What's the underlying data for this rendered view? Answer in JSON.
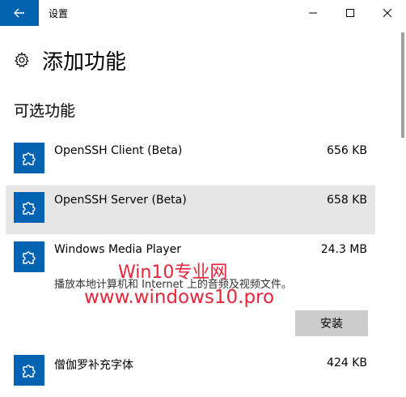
{
  "window": {
    "title": "设置"
  },
  "page": {
    "title": "添加功能"
  },
  "section": {
    "title": "可选功能"
  },
  "items": [
    {
      "name": "OpenSSH Client (Beta)",
      "size": "656 KB"
    },
    {
      "name": "OpenSSH Server (Beta)",
      "size": "658 KB"
    },
    {
      "name": "Windows Media Player",
      "size": "24.3 MB",
      "description": "播放本地计算机和 Internet 上的音频及视频文件。",
      "install_label": "安装"
    },
    {
      "name": "僧伽罗补充字体",
      "size": "424 KB"
    }
  ],
  "watermark": {
    "line1": "Win10专业网",
    "line2": "www.windows10.pro"
  },
  "colors": {
    "accent": "#0063b1",
    "selected_bg": "#e6e6e6",
    "button_bg": "#cccccc",
    "watermark": "#e0001b"
  }
}
